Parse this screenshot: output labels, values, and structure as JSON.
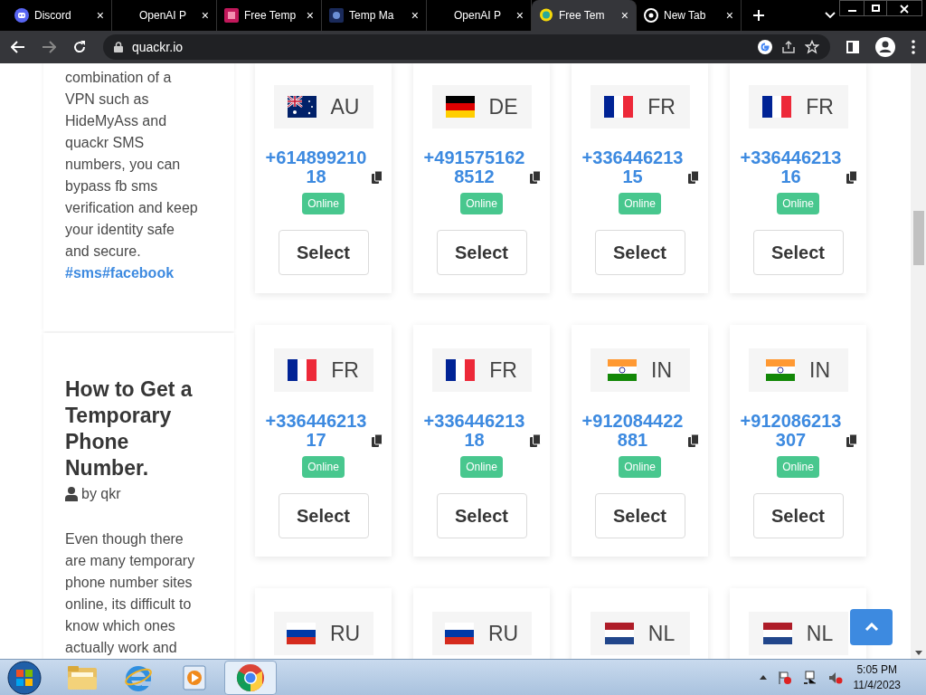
{
  "browser": {
    "tabs": [
      {
        "title": "Discord",
        "kind": "discord",
        "selected": false,
        "close": "×"
      },
      {
        "title": "OpenAI P",
        "kind": "none",
        "selected": false,
        "close": "×"
      },
      {
        "title": "Free Temp",
        "kind": "pink",
        "selected": false,
        "close": "×"
      },
      {
        "title": "Temp Ma",
        "kind": "navy",
        "selected": false,
        "close": "×"
      },
      {
        "title": "OpenAI P",
        "kind": "none",
        "selected": false,
        "close": "×"
      },
      {
        "title": "Free Tem",
        "kind": "duck",
        "selected": true,
        "close": "×"
      },
      {
        "title": "New Tab",
        "kind": "chrome",
        "selected": false,
        "close": "×"
      }
    ],
    "address": "quackr.io"
  },
  "sidebar": {
    "intro": "combination of a VPN such as HideMyAss and quackr SMS numbers, you can bypass fb sms verification and keep your identity safe and secure.",
    "tags": "#sms#facebook",
    "heading": "How to Get a Temporary Phone Number.",
    "author": "by qkr",
    "body": "Even though there are many temporary phone number sites online, its difficult to know which ones actually work and"
  },
  "numbers": [
    [
      {
        "kind": "au",
        "country": "AU",
        "number": "+61489921018",
        "status": "Online",
        "select": "Select"
      },
      {
        "kind": "de",
        "country": "DE",
        "number": "+4915751628512",
        "status": "Online",
        "select": "Select"
      },
      {
        "kind": "fr",
        "country": "FR",
        "number": "+33644621315",
        "status": "Online",
        "select": "Select"
      },
      {
        "kind": "fr",
        "country": "FR",
        "number": "+33644621316",
        "status": "Online",
        "select": "Select"
      }
    ],
    [
      {
        "kind": "fr",
        "country": "FR",
        "number": "+33644621317",
        "status": "Online",
        "select": "Select"
      },
      {
        "kind": "fr",
        "country": "FR",
        "number": "+33644621318",
        "status": "Online",
        "select": "Select"
      },
      {
        "kind": "in",
        "country": "IN",
        "number": "+912084422881",
        "status": "Online",
        "select": "Select"
      },
      {
        "kind": "in",
        "country": "IN",
        "number": "+912086213307",
        "status": "Online",
        "select": "Select"
      }
    ],
    [
      {
        "kind": "ru",
        "country": "RU"
      },
      {
        "kind": "ru",
        "country": "RU"
      },
      {
        "kind": "nl",
        "country": "NL"
      },
      {
        "kind": "nl",
        "country": "NL"
      }
    ]
  ],
  "taskbar": {
    "apps": [
      {
        "kind": "folder",
        "selected": false
      },
      {
        "kind": "ie",
        "selected": false
      },
      {
        "kind": "media",
        "selected": false
      },
      {
        "kind": "chrome",
        "selected": true
      }
    ],
    "time": "5:05 PM",
    "date": "11/4/2023"
  }
}
